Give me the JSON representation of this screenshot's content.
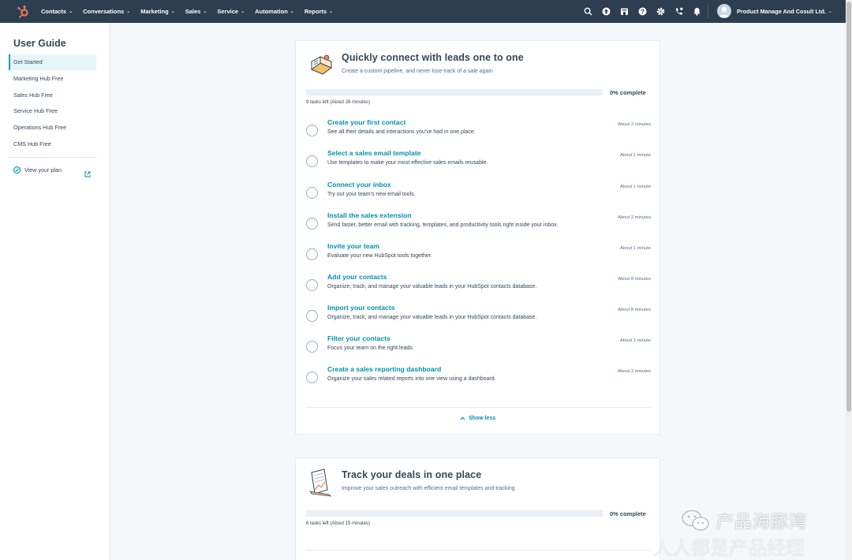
{
  "topnav": {
    "menu": [
      "Contacts",
      "Conversations",
      "Marketing",
      "Sales",
      "Service",
      "Automation",
      "Reports"
    ],
    "icons": [
      "search-icon",
      "upgrade-icon",
      "marketplace-icon",
      "help-icon",
      "settings-icon",
      "calling-icon",
      "notifications-icon"
    ],
    "account_name": "Product Manage And Cosult Ltd."
  },
  "sidebar": {
    "title": "User Guide",
    "items": [
      {
        "label": "Get Started",
        "active": true
      },
      {
        "label": "Marketing Hub Free",
        "active": false
      },
      {
        "label": "Sales Hub Free",
        "active": false
      },
      {
        "label": "Service Hub Free",
        "active": false
      },
      {
        "label": "Operations Hub Free",
        "active": false
      },
      {
        "label": "CMS Hub Free",
        "active": false
      }
    ],
    "plan_link": "View your plan"
  },
  "cards": [
    {
      "title": "Quickly connect with leads one to one",
      "subtitle": "Create a custom pipeline, and never lose track of a sale again",
      "progress": 0,
      "progress_label": "0% complete",
      "tasks_left": "9 tasks left",
      "estimate": "(About 26 minutes)",
      "tasks": [
        {
          "title": "Create your first contact",
          "desc": "See all their details and interactions you've had in one place.",
          "time": "About 2 minutes"
        },
        {
          "title": "Select a sales email template",
          "desc": "Use templates to make your most effective sales emails reusable.",
          "time": "About 1 minute"
        },
        {
          "title": "Connect your inbox",
          "desc": "Try out your team's new email tools.",
          "time": "About 1 minute"
        },
        {
          "title": "Install the sales extension",
          "desc": "Send faster, better email with tracking, templates, and productivity tools right inside your inbox.",
          "time": "About 2 minutes"
        },
        {
          "title": "Invite your team",
          "desc": "Evaluate your new HubSpot tools together.",
          "time": "About 1 minute"
        },
        {
          "title": "Add your contacts",
          "desc": "Organize, track, and manage your valuable leads in your HubSpot contacts database.",
          "time": "About 8 minutes"
        },
        {
          "title": "Import your contacts",
          "desc": "Organize, track, and manage your valuable leads in your HubSpot contacts database.",
          "time": "About 8 minutes"
        },
        {
          "title": "Filter your contacts",
          "desc": "Focus your team on the right leads.",
          "time": "About 1 minute"
        },
        {
          "title": "Create a sales reporting dashboard",
          "desc": "Organize your sales related reports into one view using a dashboard.",
          "time": "About 2 minutes"
        }
      ],
      "toggle_label": "Show less"
    },
    {
      "title": "Track your deals in one place",
      "subtitle": "Improve your sales outreach with efficient email templates and tracking",
      "progress": 0,
      "progress_label": "0% complete",
      "tasks_left": "6 tasks left",
      "estimate": "(About 15 minutes)"
    }
  ],
  "watermark": {
    "line1": "产品海豚湾",
    "line2": "人人都是产品经理"
  },
  "colors": {
    "nav_bg": "#2d3e50",
    "accent": "#0091ae",
    "active_bg": "#e5f5f8",
    "active_border": "#00a4bd",
    "logo": "#ff7a59"
  }
}
